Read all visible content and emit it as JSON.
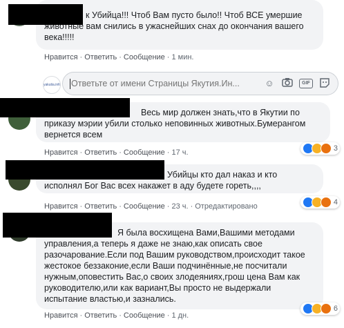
{
  "comments": [
    {
      "text_lines": [
        "к Убийца!!! Чтоб Вам пусто было!! Чтоб ВСЕ умершие",
        "животные вам снились в ужаснейших снах до окончания вашего",
        "века!!!!!"
      ],
      "actions": {
        "like": "Нравится",
        "reply": "Ответить",
        "message": "Сообщение",
        "time": "1 мин."
      }
    },
    {
      "text_lines": [
        "Весь мир должен знать,что в Якутии по",
        "приказу мэрии убили столько неповинных животных.Бумерангом",
        "вернется всем"
      ],
      "actions": {
        "like": "Нравится",
        "reply": "Ответить",
        "message": "Сообщение",
        "time": "17 ч."
      },
      "reactions": "3"
    },
    {
      "text_lines": [
        "Убийцы кто дал наказ и кто",
        "исполнял Бог Вас всех накажет в аду будете гореть,,,,"
      ],
      "actions": {
        "like": "Нравится",
        "reply": "Ответить",
        "message": "Сообщение",
        "time": "23 ч.",
        "edited": "Отредактировано"
      },
      "reactions": "4"
    },
    {
      "text_lines": [
        "Я была восхищена Вами,Вашими методами",
        "управления,а теперь я даже не знаю,как описать свое",
        "разочарование.Если под Вашим руководством,происходит такое",
        "жестокое беззаконие,если Ваши подчинённые,не посчитали",
        "нужным,оповестить Вас,о своих злодеяниях,грош цена Вам как",
        "руководителю,или как вариант,Вы просто не выдержали",
        "испытание властью,и зазнались."
      ],
      "actions": {
        "like": "Нравится",
        "reply": "Ответить",
        "message": "Сообщение",
        "time": "1 дн."
      },
      "reactions": "6"
    }
  ],
  "reply_box": {
    "placeholder": "Ответьте от имени Страницы Якутия.Ин...",
    "avatar_text": "yakutia.info"
  },
  "icons": {
    "emoji": "smile-icon",
    "camera": "camera-icon",
    "gif": "GIF",
    "sticker": "sticker-icon"
  },
  "colors": {
    "bubble": "#f2f3f5",
    "link": "#4b4f56",
    "like": "#2078f4"
  }
}
